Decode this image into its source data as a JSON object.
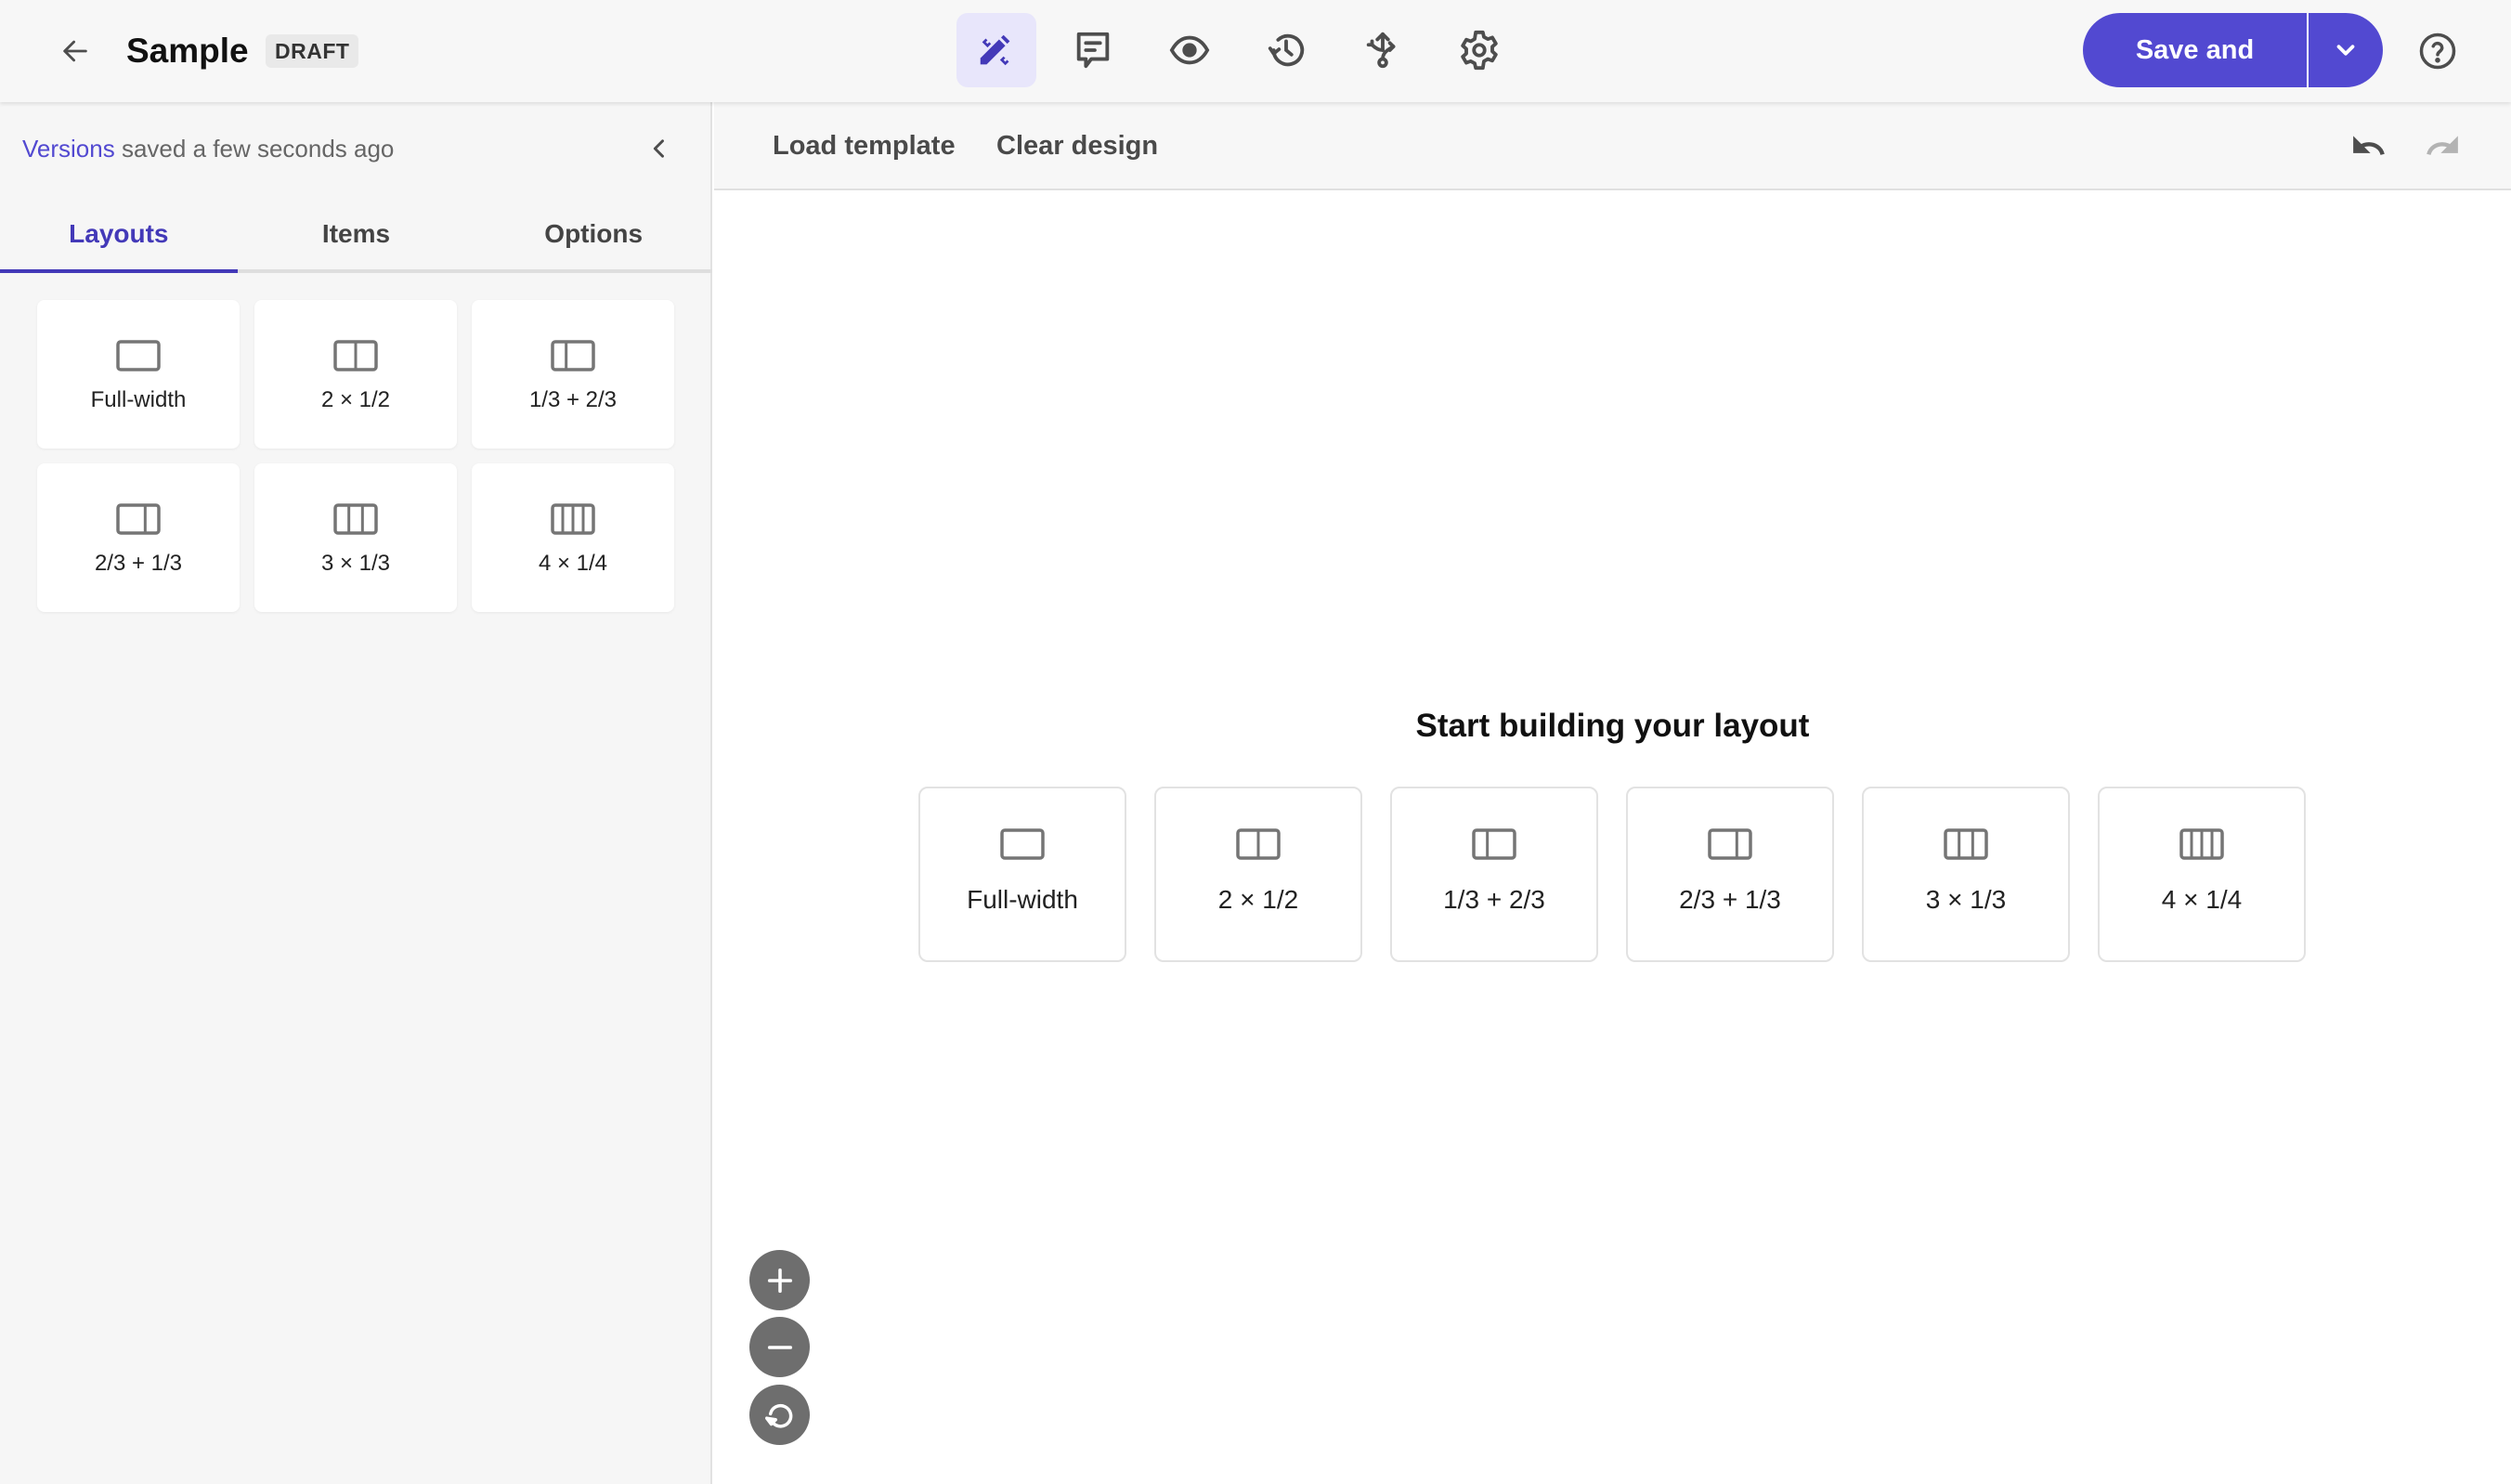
{
  "header": {
    "back_icon": "arrow-left-icon",
    "title": "Sample",
    "status_badge": "DRAFT",
    "toolbar": [
      {
        "id": "design",
        "icon": "design-tools-icon",
        "active": true
      },
      {
        "id": "comments",
        "icon": "comment-icon",
        "active": false
      },
      {
        "id": "preview",
        "icon": "eye-icon",
        "active": false
      },
      {
        "id": "history",
        "icon": "history-icon",
        "active": false
      },
      {
        "id": "routing",
        "icon": "branch-arrows-icon",
        "active": false
      },
      {
        "id": "settings",
        "icon": "gear-icon",
        "active": false
      }
    ],
    "save_label": "Save and exit",
    "save_dropdown_icon": "chevron-down-icon",
    "help_icon": "help-circle-icon"
  },
  "sidebar": {
    "versions_link": "Versions",
    "saved_text": "saved a few seconds ago",
    "collapse_icon": "chevron-left-icon",
    "tabs": [
      {
        "label": "Layouts",
        "active": true
      },
      {
        "label": "Items",
        "active": false
      },
      {
        "label": "Options",
        "active": false
      }
    ],
    "layouts": [
      {
        "label": "Full-width",
        "columns": [
          1
        ]
      },
      {
        "label": "2 × 1/2",
        "columns": [
          1,
          1
        ]
      },
      {
        "label": "1/3 + 2/3",
        "columns": [
          1,
          2
        ]
      },
      {
        "label": "2/3 + 1/3",
        "columns": [
          2,
          1
        ]
      },
      {
        "label": "3 × 1/3",
        "columns": [
          1,
          1,
          1
        ]
      },
      {
        "label": "4 × 1/4",
        "columns": [
          1,
          1,
          1,
          1
        ]
      }
    ]
  },
  "subheader": {
    "load_template": "Load template",
    "clear_design": "Clear design",
    "undo_icon": "undo-icon",
    "redo_icon": "redo-icon",
    "redo_enabled": false
  },
  "canvas": {
    "title": "Start building your layout",
    "layouts": [
      {
        "label": "Full-width",
        "columns": [
          1
        ]
      },
      {
        "label": "2 × 1/2",
        "columns": [
          1,
          1
        ]
      },
      {
        "label": "1/3 + 2/3",
        "columns": [
          1,
          2
        ]
      },
      {
        "label": "2/3 + 1/3",
        "columns": [
          2,
          1
        ]
      },
      {
        "label": "3 × 1/3",
        "columns": [
          1,
          1,
          1
        ]
      },
      {
        "label": "4 × 1/4",
        "columns": [
          1,
          1,
          1,
          1
        ]
      }
    ],
    "zoom_controls": [
      {
        "id": "zoom-in",
        "icon": "plus-icon"
      },
      {
        "id": "zoom-out",
        "icon": "minus-icon"
      },
      {
        "id": "zoom-reset",
        "icon": "reset-icon"
      }
    ]
  },
  "colors": {
    "accent": "#5249d1",
    "accent_dark": "#4339b8",
    "active_tool_bg": "#e8e6fb",
    "icon_gray": "#4d4d4d",
    "disabled_gray": "#b3b3b3",
    "zoom_button": "#6e6e6e"
  }
}
